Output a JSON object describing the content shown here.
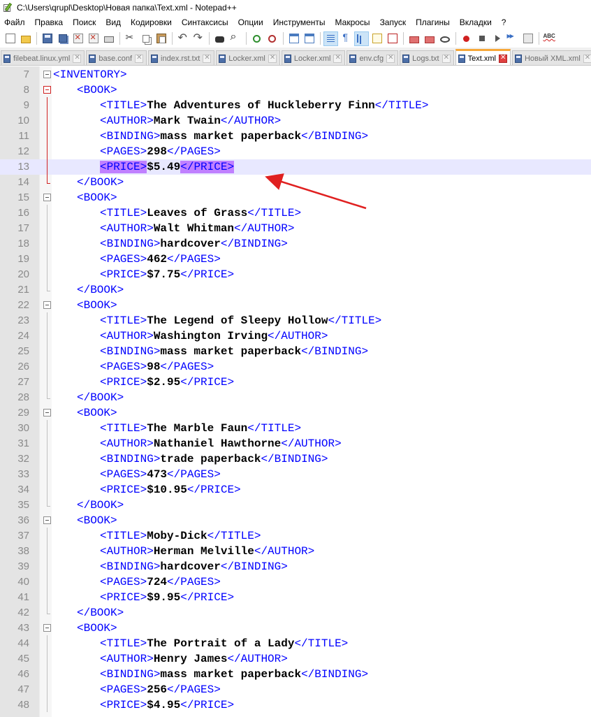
{
  "window": {
    "title": "C:\\Users\\qrupl\\Desktop\\Новая папка\\Text.xml - Notepad++"
  },
  "menu": [
    "Файл",
    "Правка",
    "Поиск",
    "Вид",
    "Кодировки",
    "Синтаксисы",
    "Опции",
    "Инструменты",
    "Макросы",
    "Запуск",
    "Плагины",
    "Вкладки",
    "?"
  ],
  "toolbar": {
    "icons": [
      "new-file-icon",
      "open-file-icon",
      "save-icon",
      "save-all-icon",
      "close-file-icon",
      "close-all-icon",
      "print-icon",
      "cut-icon",
      "copy-icon",
      "paste-icon",
      "undo-icon",
      "redo-icon",
      "find-icon",
      "replace-icon",
      "zoom-in-icon",
      "zoom-out-icon",
      "sync-vertical-icon",
      "sync-horizontal-icon",
      "word-wrap-icon",
      "show-all-chars-icon",
      "indent-guide-icon",
      "user-lang-icon",
      "doc-map-icon",
      "function-list-icon",
      "folder-workspace-icon",
      "monitoring-icon",
      "record-macro-icon",
      "stop-macro-icon",
      "play-macro-icon",
      "run-macro-multiple-icon",
      "save-macro-icon",
      "spell-check-icon"
    ]
  },
  "tabs": [
    {
      "label": "filebeat.linux.yml",
      "active": false
    },
    {
      "label": "base.conf",
      "active": false
    },
    {
      "label": "index.rst.txt",
      "active": false
    },
    {
      "label": "Locker.xml",
      "active": false
    },
    {
      "label": "Locker.xml",
      "active": false
    },
    {
      "label": "env.cfg",
      "active": false
    },
    {
      "label": "Logs.txt",
      "active": false
    },
    {
      "label": "Text.xml",
      "active": true
    },
    {
      "label": "Новый XML.xml",
      "active": false
    }
  ],
  "editor": {
    "lines": [
      {
        "n": "7",
        "indent": 0,
        "tokens": [
          [
            "tag",
            "<INVENTORY>"
          ]
        ],
        "fold": "box"
      },
      {
        "n": "8",
        "indent": 1,
        "tokens": [
          [
            "tag",
            "<BOOK>"
          ]
        ],
        "fold": "box-red"
      },
      {
        "n": "9",
        "indent": 2,
        "tokens": [
          [
            "tag",
            "<TITLE>"
          ],
          [
            "val",
            "The Adventures of Huckleberry Finn"
          ],
          [
            "tag",
            "</TITLE>"
          ]
        ],
        "fold": "vline-red"
      },
      {
        "n": "10",
        "indent": 2,
        "tokens": [
          [
            "tag",
            "<AUTHOR>"
          ],
          [
            "val",
            "Mark Twain"
          ],
          [
            "tag",
            "</AUTHOR>"
          ]
        ],
        "fold": "vline-red"
      },
      {
        "n": "11",
        "indent": 2,
        "tokens": [
          [
            "tag",
            "<BINDING>"
          ],
          [
            "val",
            "mass market paperback"
          ],
          [
            "tag",
            "</BINDING>"
          ]
        ],
        "fold": "vline-red"
      },
      {
        "n": "12",
        "indent": 2,
        "tokens": [
          [
            "tag",
            "<PAGES>"
          ],
          [
            "val",
            "298"
          ],
          [
            "tag",
            "</PAGES>"
          ]
        ],
        "fold": "vline-red"
      },
      {
        "n": "13",
        "indent": 2,
        "tokens": [
          [
            "tag-hl",
            "<PRICE>"
          ],
          [
            "val",
            "$5.49"
          ],
          [
            "tag-hl",
            "</PRICE>"
          ]
        ],
        "fold": "vline-red",
        "current": true
      },
      {
        "n": "14",
        "indent": 1,
        "tokens": [
          [
            "tag",
            "</BOOK>"
          ]
        ],
        "fold": "tick-red"
      },
      {
        "n": "15",
        "indent": 1,
        "tokens": [
          [
            "tag",
            "<BOOK>"
          ]
        ],
        "fold": "box"
      },
      {
        "n": "16",
        "indent": 2,
        "tokens": [
          [
            "tag",
            "<TITLE>"
          ],
          [
            "val",
            "Leaves of Grass"
          ],
          [
            "tag",
            "</TITLE>"
          ]
        ],
        "fold": "vline"
      },
      {
        "n": "17",
        "indent": 2,
        "tokens": [
          [
            "tag",
            "<AUTHOR>"
          ],
          [
            "val",
            "Walt Whitman"
          ],
          [
            "tag",
            "</AUTHOR>"
          ]
        ],
        "fold": "vline"
      },
      {
        "n": "18",
        "indent": 2,
        "tokens": [
          [
            "tag",
            "<BINDING>"
          ],
          [
            "val",
            "hardcover"
          ],
          [
            "tag",
            "</BINDING>"
          ]
        ],
        "fold": "vline"
      },
      {
        "n": "19",
        "indent": 2,
        "tokens": [
          [
            "tag",
            "<PAGES>"
          ],
          [
            "val",
            "462"
          ],
          [
            "tag",
            "</PAGES>"
          ]
        ],
        "fold": "vline"
      },
      {
        "n": "20",
        "indent": 2,
        "tokens": [
          [
            "tag",
            "<PRICE>"
          ],
          [
            "val",
            "$7.75"
          ],
          [
            "tag",
            "</PRICE>"
          ]
        ],
        "fold": "vline"
      },
      {
        "n": "21",
        "indent": 1,
        "tokens": [
          [
            "tag",
            "</BOOK>"
          ]
        ],
        "fold": "tick"
      },
      {
        "n": "22",
        "indent": 1,
        "tokens": [
          [
            "tag",
            "<BOOK>"
          ]
        ],
        "fold": "box"
      },
      {
        "n": "23",
        "indent": 2,
        "tokens": [
          [
            "tag",
            "<TITLE>"
          ],
          [
            "val",
            "The Legend of Sleepy Hollow"
          ],
          [
            "tag",
            "</TITLE>"
          ]
        ],
        "fold": "vline"
      },
      {
        "n": "24",
        "indent": 2,
        "tokens": [
          [
            "tag",
            "<AUTHOR>"
          ],
          [
            "val",
            "Washington Irving"
          ],
          [
            "tag",
            "</AUTHOR>"
          ]
        ],
        "fold": "vline"
      },
      {
        "n": "25",
        "indent": 2,
        "tokens": [
          [
            "tag",
            "<BINDING>"
          ],
          [
            "val",
            "mass market paperback"
          ],
          [
            "tag",
            "</BINDING>"
          ]
        ],
        "fold": "vline"
      },
      {
        "n": "26",
        "indent": 2,
        "tokens": [
          [
            "tag",
            "<PAGES>"
          ],
          [
            "val",
            "98"
          ],
          [
            "tag",
            "</PAGES>"
          ]
        ],
        "fold": "vline"
      },
      {
        "n": "27",
        "indent": 2,
        "tokens": [
          [
            "tag",
            "<PRICE>"
          ],
          [
            "val",
            "$2.95"
          ],
          [
            "tag",
            "</PRICE>"
          ]
        ],
        "fold": "vline"
      },
      {
        "n": "28",
        "indent": 1,
        "tokens": [
          [
            "tag",
            "</BOOK>"
          ]
        ],
        "fold": "tick"
      },
      {
        "n": "29",
        "indent": 1,
        "tokens": [
          [
            "tag",
            "<BOOK>"
          ]
        ],
        "fold": "box"
      },
      {
        "n": "30",
        "indent": 2,
        "tokens": [
          [
            "tag",
            "<TITLE>"
          ],
          [
            "val",
            "The Marble Faun"
          ],
          [
            "tag",
            "</TITLE>"
          ]
        ],
        "fold": "vline"
      },
      {
        "n": "31",
        "indent": 2,
        "tokens": [
          [
            "tag",
            "<AUTHOR>"
          ],
          [
            "val",
            "Nathaniel Hawthorne"
          ],
          [
            "tag",
            "</AUTHOR>"
          ]
        ],
        "fold": "vline"
      },
      {
        "n": "32",
        "indent": 2,
        "tokens": [
          [
            "tag",
            "<BINDING>"
          ],
          [
            "val",
            "trade paperback"
          ],
          [
            "tag",
            "</BINDING>"
          ]
        ],
        "fold": "vline"
      },
      {
        "n": "33",
        "indent": 2,
        "tokens": [
          [
            "tag",
            "<PAGES>"
          ],
          [
            "val",
            "473"
          ],
          [
            "tag",
            "</PAGES>"
          ]
        ],
        "fold": "vline"
      },
      {
        "n": "34",
        "indent": 2,
        "tokens": [
          [
            "tag",
            "<PRICE>"
          ],
          [
            "val",
            "$10.95"
          ],
          [
            "tag",
            "</PRICE>"
          ]
        ],
        "fold": "vline"
      },
      {
        "n": "35",
        "indent": 1,
        "tokens": [
          [
            "tag",
            "</BOOK>"
          ]
        ],
        "fold": "tick"
      },
      {
        "n": "36",
        "indent": 1,
        "tokens": [
          [
            "tag",
            "<BOOK>"
          ]
        ],
        "fold": "box"
      },
      {
        "n": "37",
        "indent": 2,
        "tokens": [
          [
            "tag",
            "<TITLE>"
          ],
          [
            "val",
            "Moby-Dick"
          ],
          [
            "tag",
            "</TITLE>"
          ]
        ],
        "fold": "vline"
      },
      {
        "n": "38",
        "indent": 2,
        "tokens": [
          [
            "tag",
            "<AUTHOR>"
          ],
          [
            "val",
            "Herman Melville"
          ],
          [
            "tag",
            "</AUTHOR>"
          ]
        ],
        "fold": "vline"
      },
      {
        "n": "39",
        "indent": 2,
        "tokens": [
          [
            "tag",
            "<BINDING>"
          ],
          [
            "val",
            "hardcover"
          ],
          [
            "tag",
            "</BINDING>"
          ]
        ],
        "fold": "vline"
      },
      {
        "n": "40",
        "indent": 2,
        "tokens": [
          [
            "tag",
            "<PAGES>"
          ],
          [
            "val",
            "724"
          ],
          [
            "tag",
            "</PAGES>"
          ]
        ],
        "fold": "vline"
      },
      {
        "n": "41",
        "indent": 2,
        "tokens": [
          [
            "tag",
            "<PRICE>"
          ],
          [
            "val",
            "$9.95"
          ],
          [
            "tag",
            "</PRICE>"
          ]
        ],
        "fold": "vline"
      },
      {
        "n": "42",
        "indent": 1,
        "tokens": [
          [
            "tag",
            "</BOOK>"
          ]
        ],
        "fold": "tick"
      },
      {
        "n": "43",
        "indent": 1,
        "tokens": [
          [
            "tag",
            "<BOOK>"
          ]
        ],
        "fold": "box"
      },
      {
        "n": "44",
        "indent": 2,
        "tokens": [
          [
            "tag",
            "<TITLE>"
          ],
          [
            "val",
            "The Portrait of a Lady"
          ],
          [
            "tag",
            "</TITLE>"
          ]
        ],
        "fold": "vline"
      },
      {
        "n": "45",
        "indent": 2,
        "tokens": [
          [
            "tag",
            "<AUTHOR>"
          ],
          [
            "val",
            "Henry James"
          ],
          [
            "tag",
            "</AUTHOR>"
          ]
        ],
        "fold": "vline"
      },
      {
        "n": "46",
        "indent": 2,
        "tokens": [
          [
            "tag",
            "<BINDING>"
          ],
          [
            "val",
            "mass market paperback"
          ],
          [
            "tag",
            "</BINDING>"
          ]
        ],
        "fold": "vline"
      },
      {
        "n": "47",
        "indent": 2,
        "tokens": [
          [
            "tag",
            "<PAGES>"
          ],
          [
            "val",
            "256"
          ],
          [
            "tag",
            "</PAGES>"
          ]
        ],
        "fold": "vline"
      },
      {
        "n": "48",
        "indent": 2,
        "tokens": [
          [
            "tag",
            "<PRICE>"
          ],
          [
            "val",
            "$4.95"
          ],
          [
            "tag",
            "</PRICE>"
          ]
        ],
        "fold": "vline"
      }
    ]
  },
  "annotation": {
    "arrow_color": "#e02020"
  },
  "colors": {
    "tag": "#0000ff",
    "current_line": "#e8e8ff",
    "match_highlight": "#c080ff",
    "active_tab_accent": "#f7a738"
  }
}
